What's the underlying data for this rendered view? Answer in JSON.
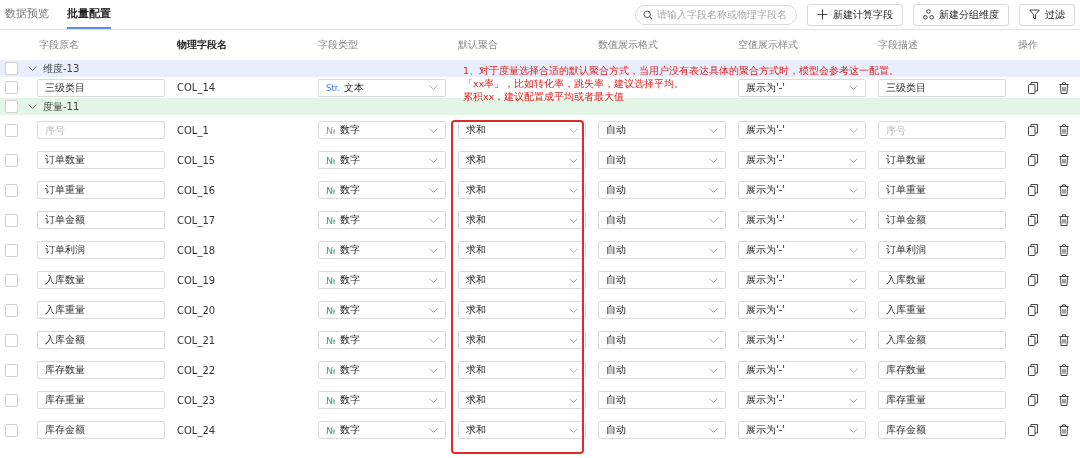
{
  "tabs": [
    {
      "label": "数据预览",
      "selected": false
    },
    {
      "label": "批量配置",
      "selected": true
    }
  ],
  "search": {
    "placeholder": "请输入字段名称或物理字段名"
  },
  "buttons": [
    {
      "label": "新建计算字段",
      "kind": "add"
    },
    {
      "label": "新建分组维度",
      "kind": "group"
    },
    {
      "label": "过滤",
      "kind": "filter"
    }
  ],
  "columns": [
    "字段原名",
    "物理字段名",
    "字段类型",
    "默认聚合",
    "数值展示格式",
    "空值展示样式",
    "字段描述",
    "操作"
  ],
  "groups": [
    {
      "label": "维度-13",
      "kind": "dimension",
      "expanded": true,
      "checked": false,
      "rows": [
        {
          "checked": false,
          "name": "三级类目",
          "physical": "COL_14",
          "type": {
            "badge": "Str.",
            "label": "文本",
            "kind": "text",
            "disabled": false
          },
          "null_style": "展示为'-'",
          "description": "三级类目"
        }
      ]
    },
    {
      "label": "度量-11",
      "kind": "measure",
      "expanded": true,
      "checked": false,
      "rows": [
        {
          "checked": false,
          "name_placeholder": "序号",
          "physical": "COL_1",
          "type": {
            "badge": "№",
            "label": "数字",
            "kind": "number",
            "disabled": true
          },
          "aggregation": "求和",
          "format": "自动",
          "null_style": "展示为'-'",
          "description_placeholder": "序号"
        },
        {
          "checked": false,
          "name": "订单数量",
          "physical": "COL_15",
          "type": {
            "badge": "№",
            "label": "数字",
            "kind": "number",
            "disabled": false
          },
          "aggregation": "求和",
          "format": "自动",
          "null_style": "展示为'-'",
          "description": "订单数量"
        },
        {
          "checked": false,
          "name": "订单重量",
          "physical": "COL_16",
          "type": {
            "badge": "№",
            "label": "数字",
            "kind": "number",
            "disabled": false
          },
          "aggregation": "求和",
          "format": "自动",
          "null_style": "展示为'-'",
          "description": "订单重量"
        },
        {
          "checked": false,
          "name": "订单金额",
          "physical": "COL_17",
          "type": {
            "badge": "№",
            "label": "数字",
            "kind": "number",
            "disabled": false
          },
          "aggregation": "求和",
          "format": "自动",
          "null_style": "展示为'-'",
          "description": "订单金额"
        },
        {
          "checked": false,
          "name": "订单利润",
          "physical": "COL_18",
          "type": {
            "badge": "№",
            "label": "数字",
            "kind": "number",
            "disabled": false
          },
          "aggregation": "求和",
          "format": "自动",
          "null_style": "展示为'-'",
          "description": "订单利润"
        },
        {
          "checked": false,
          "name": "入库数量",
          "physical": "COL_19",
          "type": {
            "badge": "№",
            "label": "数字",
            "kind": "number",
            "disabled": false
          },
          "aggregation": "求和",
          "format": "自动",
          "null_style": "展示为'-'",
          "description": "入库数量"
        },
        {
          "checked": false,
          "name": "入库重量",
          "physical": "COL_20",
          "type": {
            "badge": "№",
            "label": "数字",
            "kind": "number",
            "disabled": false
          },
          "aggregation": "求和",
          "format": "自动",
          "null_style": "展示为'-'",
          "description": "入库重量"
        },
        {
          "checked": false,
          "name": "入库金额",
          "physical": "COL_21",
          "type": {
            "badge": "№",
            "label": "数字",
            "kind": "number",
            "disabled": false
          },
          "aggregation": "求和",
          "format": "自动",
          "null_style": "展示为'-'",
          "description": "入库金额"
        },
        {
          "checked": false,
          "name": "库存数量",
          "physical": "COL_22",
          "type": {
            "badge": "№",
            "label": "数字",
            "kind": "number",
            "disabled": false
          },
          "aggregation": "求和",
          "format": "自动",
          "null_style": "展示为'-'",
          "description": "库存数量"
        },
        {
          "checked": false,
          "name": "库存重量",
          "physical": "COL_23",
          "type": {
            "badge": "№",
            "label": "数字",
            "kind": "number",
            "disabled": false
          },
          "aggregation": "求和",
          "format": "自动",
          "null_style": "展示为'-'",
          "description": "库存重量"
        },
        {
          "checked": false,
          "name": "库存金额",
          "physical": "COL_24",
          "type": {
            "badge": "№",
            "label": "数字",
            "kind": "number",
            "disabled": false
          },
          "aggregation": "求和",
          "format": "自动",
          "null_style": "展示为'-'",
          "description": "库存金额"
        }
      ]
    }
  ],
  "annotation": {
    "lines": [
      "1、对于度量选择合适的默认聚合方式，当用户没有表达具体的聚合方式时，模型会参考这一配置。",
      "「xx率」，比如转化率，跳失率，建议选择平均。",
      "累积xx，建议配置成平均或者最大值"
    ]
  }
}
